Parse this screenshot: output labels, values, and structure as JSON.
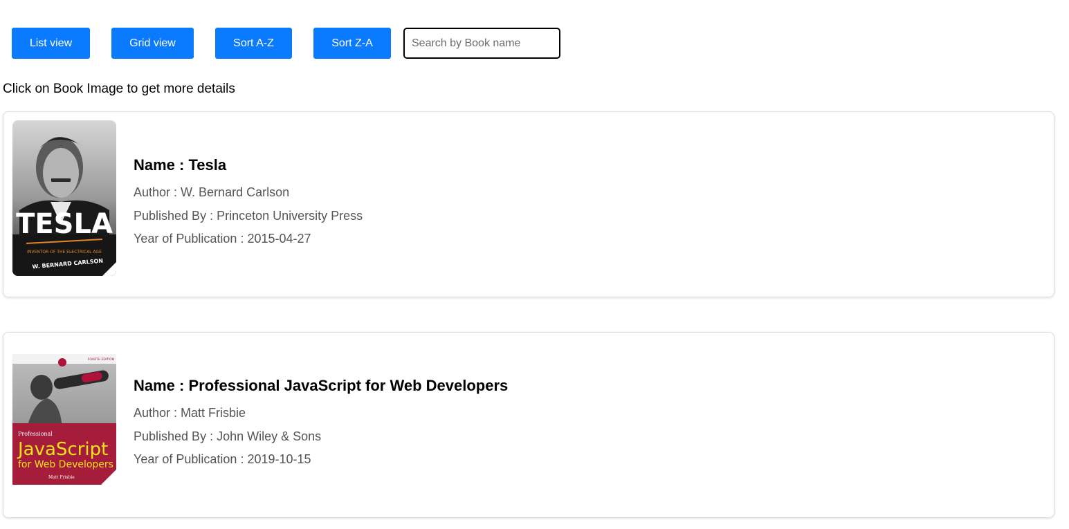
{
  "toolbar": {
    "list_view_label": "List view",
    "grid_view_label": "Grid view",
    "sort_az_label": "Sort A-Z",
    "sort_za_label": "Sort Z-A",
    "search_placeholder": "Search by Book name",
    "search_value": ""
  },
  "hint": "Click on Book Image to get more details",
  "labels": {
    "name": "Name : ",
    "author": "Author : ",
    "publisher": "Published By : ",
    "year": "Year of Publication : "
  },
  "books": [
    {
      "name": "Tesla",
      "author": "W. Bernard Carlson",
      "publisher": "Princeton University Press",
      "year": "2015-04-27",
      "cover_title": "TESLA",
      "cover_subtitle": "INVENTOR OF THE ELECTRICAL AGE",
      "cover_author": "W. BERNARD CARLSON"
    },
    {
      "name": "Professional JavaScript for Web Developers",
      "author": "Matt Frisbie",
      "publisher": "John Wiley & Sons",
      "year": "2019-10-15",
      "cover_edition": "FOURTH EDITION",
      "cover_small": "Professional",
      "cover_title": "JavaScript",
      "cover_subtitle": "for Web Developers",
      "cover_author": "Matt Frisbie"
    }
  ],
  "colors": {
    "button": "#0a7bff",
    "meta_text": "#555555",
    "border": "#dcdcdc"
  }
}
